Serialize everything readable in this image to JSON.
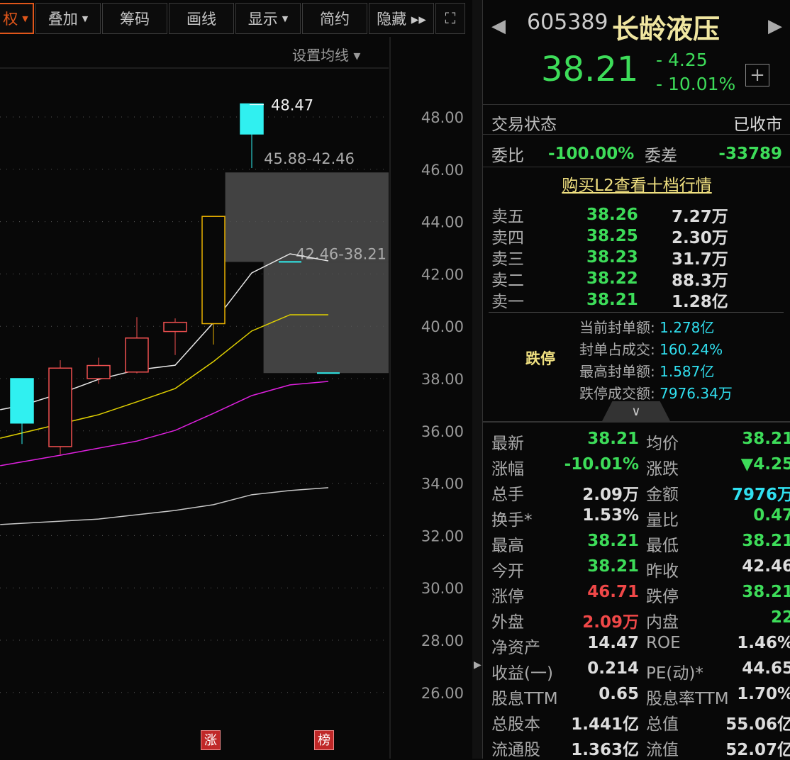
{
  "toolbar": {
    "items": [
      {
        "label": "权",
        "dropdown": true,
        "active": true
      },
      {
        "label": "叠加",
        "dropdown": true
      },
      {
        "label": "筹码"
      },
      {
        "label": "画线"
      },
      {
        "label": "显示",
        "dropdown": true
      },
      {
        "label": "简约"
      },
      {
        "label": "隐藏 ▸▸"
      }
    ],
    "fullscreen_icon": "expand-icon",
    "set_ma": "设置均线 ▾"
  },
  "chart_data": {
    "type": "candlestick",
    "ylim": [
      25,
      49.5
    ],
    "yticks": [
      "48.00",
      "46.00",
      "44.00",
      "42.00",
      "40.00",
      "38.00",
      "36.00",
      "34.00",
      "32.00",
      "30.00",
      "28.00",
      "26.00"
    ],
    "candles": [
      {
        "o": 38.0,
        "h": 38.0,
        "l": 35.5,
        "c": 36.3
      },
      {
        "o": 35.4,
        "h": 38.7,
        "l": 35.1,
        "c": 38.4
      },
      {
        "o": 38.0,
        "h": 38.8,
        "l": 37.8,
        "c": 38.5
      },
      {
        "o": 38.25,
        "h": 40.35,
        "l": 38.2,
        "c": 39.55
      },
      {
        "o": 39.8,
        "h": 40.3,
        "l": 38.9,
        "c": 40.15
      },
      {
        "o": 40.1,
        "h": 44.2,
        "l": 39.3,
        "c": 44.2
      },
      {
        "o": 48.5,
        "h": 48.5,
        "l": 46.05,
        "c": 47.35
      },
      {
        "o": 42.46,
        "h": 42.46,
        "l": 42.46,
        "c": 42.46
      },
      {
        "o": 38.21,
        "h": 38.21,
        "l": 38.21,
        "c": 38.21
      }
    ],
    "ma": [
      {
        "color": "#e8e8e8",
        "x": [
          -0.57,
          0,
          1,
          2,
          3,
          4,
          5,
          6,
          7,
          8
        ],
        "y": [
          36.81,
          36.97,
          37.43,
          37.97,
          38.33,
          38.51,
          40.14,
          42.04,
          42.77,
          42.5
        ]
      },
      {
        "color": "#e0d000",
        "x": [
          -0.57,
          1,
          2,
          3,
          4,
          5,
          6,
          7,
          8
        ],
        "y": [
          35.72,
          36.27,
          36.62,
          37.11,
          37.62,
          38.65,
          39.82,
          40.44,
          40.44
        ]
      },
      {
        "color": "#e020e0",
        "x": [
          -0.57,
          1,
          3,
          4,
          5,
          6,
          7,
          8
        ],
        "y": [
          34.67,
          35.07,
          35.61,
          36.02,
          36.67,
          37.35,
          37.76,
          37.89
        ]
      },
      {
        "color": "#c8c8c8",
        "x": [
          -0.57,
          2,
          4,
          5,
          6,
          7,
          8
        ],
        "y": [
          32.42,
          32.63,
          32.96,
          33.18,
          33.56,
          33.72,
          33.83
        ]
      }
    ],
    "high_label": "48.47",
    "gaps": [
      {
        "label": "45.88-42.46",
        "top": 45.88,
        "bottom": 42.46,
        "from": 5.9
      },
      {
        "label": "42.46-38.21",
        "top": 42.46,
        "bottom": 38.21,
        "from": 6.9
      }
    ],
    "markers": [
      "涨",
      "榜"
    ]
  },
  "quote": {
    "code": "605389",
    "name": "长龄液压",
    "price": "38.21",
    "change": "- 4.25",
    "pct": "- 10.01%",
    "status_label": "交易状态",
    "status": "已收市",
    "wb_label": "委比",
    "wb": "-100.00%",
    "wc_label": "委差",
    "wc": "-33789",
    "l2_link": "购买L2查看十档行情"
  },
  "orderbook": [
    {
      "name": "卖五",
      "price": "38.26",
      "vol": "7.27万"
    },
    {
      "name": "卖四",
      "price": "38.25",
      "vol": "2.30万"
    },
    {
      "name": "卖三",
      "price": "38.23",
      "vol": "31.7万"
    },
    {
      "name": "卖二",
      "price": "38.22",
      "vol": "88.3万"
    },
    {
      "name": "卖一",
      "price": "38.21",
      "vol": "1.28亿"
    }
  ],
  "limit": {
    "tag": "跌停",
    "rows": [
      {
        "label": "当前封单额:",
        "value": "1.278亿"
      },
      {
        "label": "封单占成交:",
        "value": "160.24%"
      },
      {
        "label": "最高封单额:",
        "value": "1.587亿"
      },
      {
        "label": "跌停成交额:",
        "value": "7976.34万"
      }
    ]
  },
  "stats": [
    {
      "label": "最新",
      "value": "38.21",
      "color": "g"
    },
    {
      "label": "均价",
      "value": "38.21",
      "color": "g"
    },
    {
      "label": "涨幅",
      "value": "-10.01%",
      "color": "g"
    },
    {
      "label": "涨跌",
      "value": "▼4.25",
      "color": "g"
    },
    {
      "label": "总手",
      "value": "2.09万",
      "color": "w"
    },
    {
      "label": "金额",
      "value": "7976万",
      "color": "c"
    },
    {
      "label": "换手*",
      "value": "1.53%",
      "color": "w"
    },
    {
      "label": "量比",
      "value": "0.47",
      "color": "g"
    },
    {
      "label": "最高",
      "value": "38.21",
      "color": "g"
    },
    {
      "label": "最低",
      "value": "38.21",
      "color": "g"
    },
    {
      "label": "今开",
      "value": "38.21",
      "color": "g"
    },
    {
      "label": "昨收",
      "value": "42.46",
      "color": "w"
    },
    {
      "label": "涨停",
      "value": "46.71",
      "color": "r"
    },
    {
      "label": "跌停",
      "value": "38.21",
      "color": "g"
    },
    {
      "label": "外盘",
      "value": "2.09万",
      "color": "r"
    },
    {
      "label": "内盘",
      "value": "22",
      "color": "g"
    },
    {
      "label": "净资产",
      "value": "14.47",
      "color": "w"
    },
    {
      "label": "ROE",
      "value": "1.46%",
      "color": "w"
    },
    {
      "label": "收益(一)",
      "value": "0.214",
      "color": "w"
    },
    {
      "label": "PE(动)*",
      "value": "44.65",
      "color": "w"
    },
    {
      "label": "股息TTM",
      "value": "0.65",
      "color": "w"
    },
    {
      "label": "股息率TTM",
      "value": "1.70%",
      "color": "w"
    },
    {
      "label": "总股本",
      "value": "1.441亿",
      "color": "w"
    },
    {
      "label": "总值",
      "value": "55.06亿",
      "color": "w"
    },
    {
      "label": "流通股",
      "value": "1.363亿",
      "color": "w"
    },
    {
      "label": "流值",
      "value": "52.07亿",
      "color": "w"
    }
  ]
}
